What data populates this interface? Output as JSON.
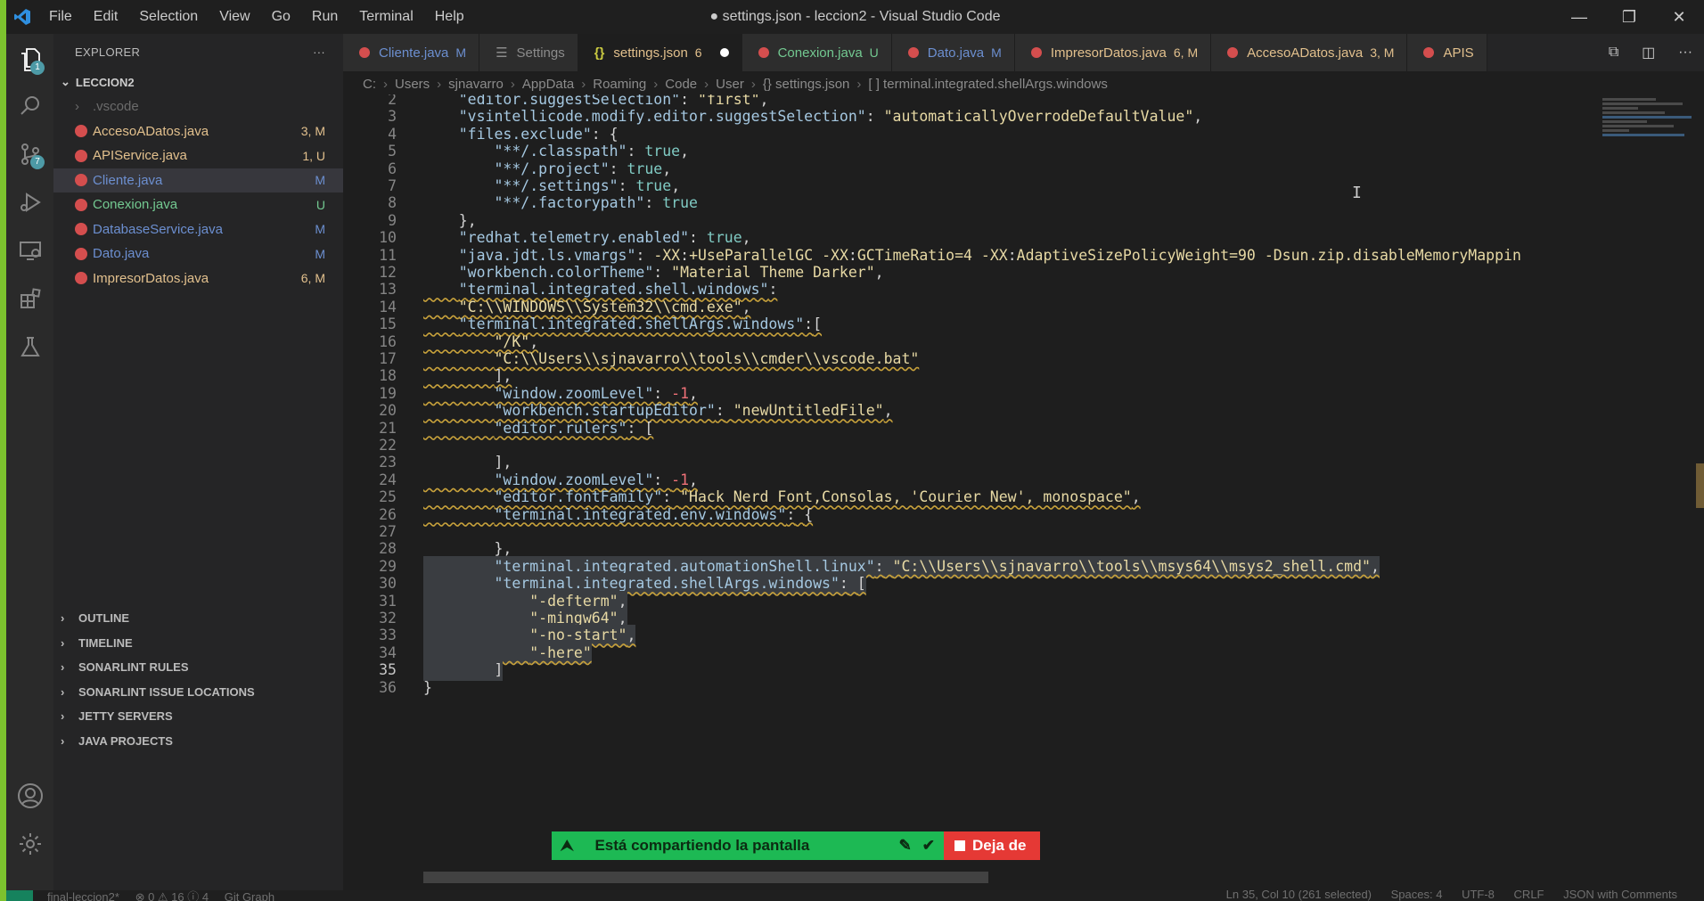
{
  "window": {
    "title": "● settings.json - leccion2 - Visual Studio Code",
    "menu": [
      "File",
      "Edit",
      "Selection",
      "View",
      "Go",
      "Run",
      "Terminal",
      "Help"
    ],
    "controls": [
      "—",
      "❐",
      "✕"
    ]
  },
  "activity": {
    "explorer_badge": "1",
    "scm_badge": "7",
    "icons": [
      "files-icon",
      "search-icon",
      "source-control-icon",
      "run-debug-icon",
      "remote-explorer-icon",
      "extensions-icon",
      "testing-icon",
      "account-icon",
      "settings-gear-icon"
    ]
  },
  "sidebar": {
    "title": "EXPLORER",
    "more": "···",
    "folder": "LECCION2",
    "files": [
      {
        "name": ".vscode",
        "status": "",
        "folder": true
      },
      {
        "name": "AccesoADatos.java",
        "status": "3, M",
        "color": "#e2c08d"
      },
      {
        "name": "APIService.java",
        "status": "1, U",
        "color": "#e2c08d"
      },
      {
        "name": "Cliente.java",
        "status": "M",
        "color": "#6c8fd0"
      },
      {
        "name": "Conexion.java",
        "status": "U",
        "color": "#73c991"
      },
      {
        "name": "DatabaseService.java",
        "status": "M",
        "color": "#6c8fd0"
      },
      {
        "name": "Dato.java",
        "status": "M",
        "color": "#6c8fd0"
      },
      {
        "name": "ImpresorDatos.java",
        "status": "6, M",
        "color": "#e2c08d"
      }
    ],
    "panels": [
      "OUTLINE",
      "TIMELINE",
      "SONARLINT RULES",
      "SONARLINT ISSUE LOCATIONS",
      "JETTY SERVERS",
      "JAVA PROJECTS"
    ]
  },
  "tabs": [
    {
      "label": "Cliente.java",
      "status": "M",
      "color": "#6c8fd0",
      "icon": "java"
    },
    {
      "label": "Settings",
      "status": "",
      "color": "#8b8b8b",
      "icon": "settings"
    },
    {
      "label": "settings.json",
      "status": "6",
      "color": "#e2c08d",
      "icon": "json",
      "active": true,
      "dirty": true
    },
    {
      "label": "Conexion.java",
      "status": "U",
      "color": "#73c991",
      "icon": "java"
    },
    {
      "label": "Dato.java",
      "status": "M",
      "color": "#6c8fd0",
      "icon": "java"
    },
    {
      "label": "ImpresorDatos.java",
      "status": "6, M",
      "color": "#e2c08d",
      "icon": "java"
    },
    {
      "label": "AccesoADatos.java",
      "status": "3, M",
      "color": "#e2c08d",
      "icon": "java"
    },
    {
      "label": "APIS",
      "status": "",
      "color": "#e2c08d",
      "icon": "java"
    }
  ],
  "breadcrumb": [
    "C:",
    "Users",
    "sjnavarro",
    "AppData",
    "Roaming",
    "Code",
    "User",
    "{} settings.json",
    "[ ] terminal.integrated.shellArgs.windows"
  ],
  "editor": {
    "current_line": 35,
    "lines": [
      {
        "n": 2,
        "t": "    \"editor.suggestSelection\": \"first\","
      },
      {
        "n": 3,
        "t": "    \"vsintellicode.modify.editor.suggestSelection\": \"automaticallyOverrodeDefaultValue\","
      },
      {
        "n": 4,
        "t": "    \"files.exclude\": {"
      },
      {
        "n": 5,
        "t": "        \"**/.classpath\": true,"
      },
      {
        "n": 6,
        "t": "        \"**/.project\": true,"
      },
      {
        "n": 7,
        "t": "        \"**/.settings\": true,"
      },
      {
        "n": 8,
        "t": "        \"**/.factorypath\": true"
      },
      {
        "n": 9,
        "t": "    },"
      },
      {
        "n": 10,
        "t": "    \"redhat.telemetry.enabled\": true,"
      },
      {
        "n": 11,
        "t": "    \"java.jdt.ls.vmargs\": \"-XX:+UseParallelGC -XX:GCTimeRatio=4 -XX:AdaptiveSizePolicyWeight=90 -Dsun.zip.disableMemoryMappin"
      },
      {
        "n": 12,
        "t": "    \"workbench.colorTheme\": \"Material Theme Darker\","
      },
      {
        "n": 13,
        "t": "    \"terminal.integrated.shell.windows\":"
      },
      {
        "n": 14,
        "t": "    \"C:\\\\WINDOWS\\\\System32\\\\cmd.exe\","
      },
      {
        "n": 15,
        "t": "    \"terminal.integrated.shellArgs.windows\":["
      },
      {
        "n": 16,
        "t": "        \"/K\","
      },
      {
        "n": 17,
        "t": "        \"C:\\\\Users\\\\sjnavarro\\\\tools\\\\cmder\\\\vscode.bat\""
      },
      {
        "n": 18,
        "t": "        ],"
      },
      {
        "n": 19,
        "t": "        \"window.zoomLevel\": -1,"
      },
      {
        "n": 20,
        "t": "        \"workbench.startupEditor\": \"newUntitledFile\","
      },
      {
        "n": 21,
        "t": "        \"editor.rulers\": ["
      },
      {
        "n": 22,
        "t": ""
      },
      {
        "n": 23,
        "t": "        ],"
      },
      {
        "n": 24,
        "t": "        \"window.zoomLevel\": -1,"
      },
      {
        "n": 25,
        "t": "        \"editor.fontFamily\": \"Hack Nerd Font,Consolas, 'Courier New', monospace\","
      },
      {
        "n": 26,
        "t": "        \"terminal.integrated.env.windows\": {"
      },
      {
        "n": 27,
        "t": ""
      },
      {
        "n": 28,
        "t": "        },"
      },
      {
        "n": 29,
        "t": "        \"terminal.integrated.automationShell.linux\": \"C:\\\\Users\\\\sjnavarro\\\\tools\\\\msys64\\\\msys2_shell.cmd\","
      },
      {
        "n": 30,
        "t": "        \"terminal.integrated.shellArgs.windows\": ["
      },
      {
        "n": 31,
        "t": "            \"-defterm\","
      },
      {
        "n": 32,
        "t": "            \"-mingw64\","
      },
      {
        "n": 33,
        "t": "            \"-no-start\","
      },
      {
        "n": 34,
        "t": "            \"-here\""
      },
      {
        "n": 35,
        "t": "        ]"
      },
      {
        "n": 36,
        "t": "}"
      }
    ]
  },
  "share_banner": {
    "message": "Está compartiendo la pantalla",
    "stop_label": "Deja de"
  },
  "status": {
    "branch": "final-leccion2*",
    "problems": "⊗ 0 ⚠ 16 ⓘ 4",
    "git_graph": "Git Graph",
    "position": "Ln 35, Col 10 (261 selected)",
    "spaces": "Spaces: 4",
    "encoding": "UTF-8",
    "eol": "CRLF",
    "language": "JSON with Comments"
  }
}
